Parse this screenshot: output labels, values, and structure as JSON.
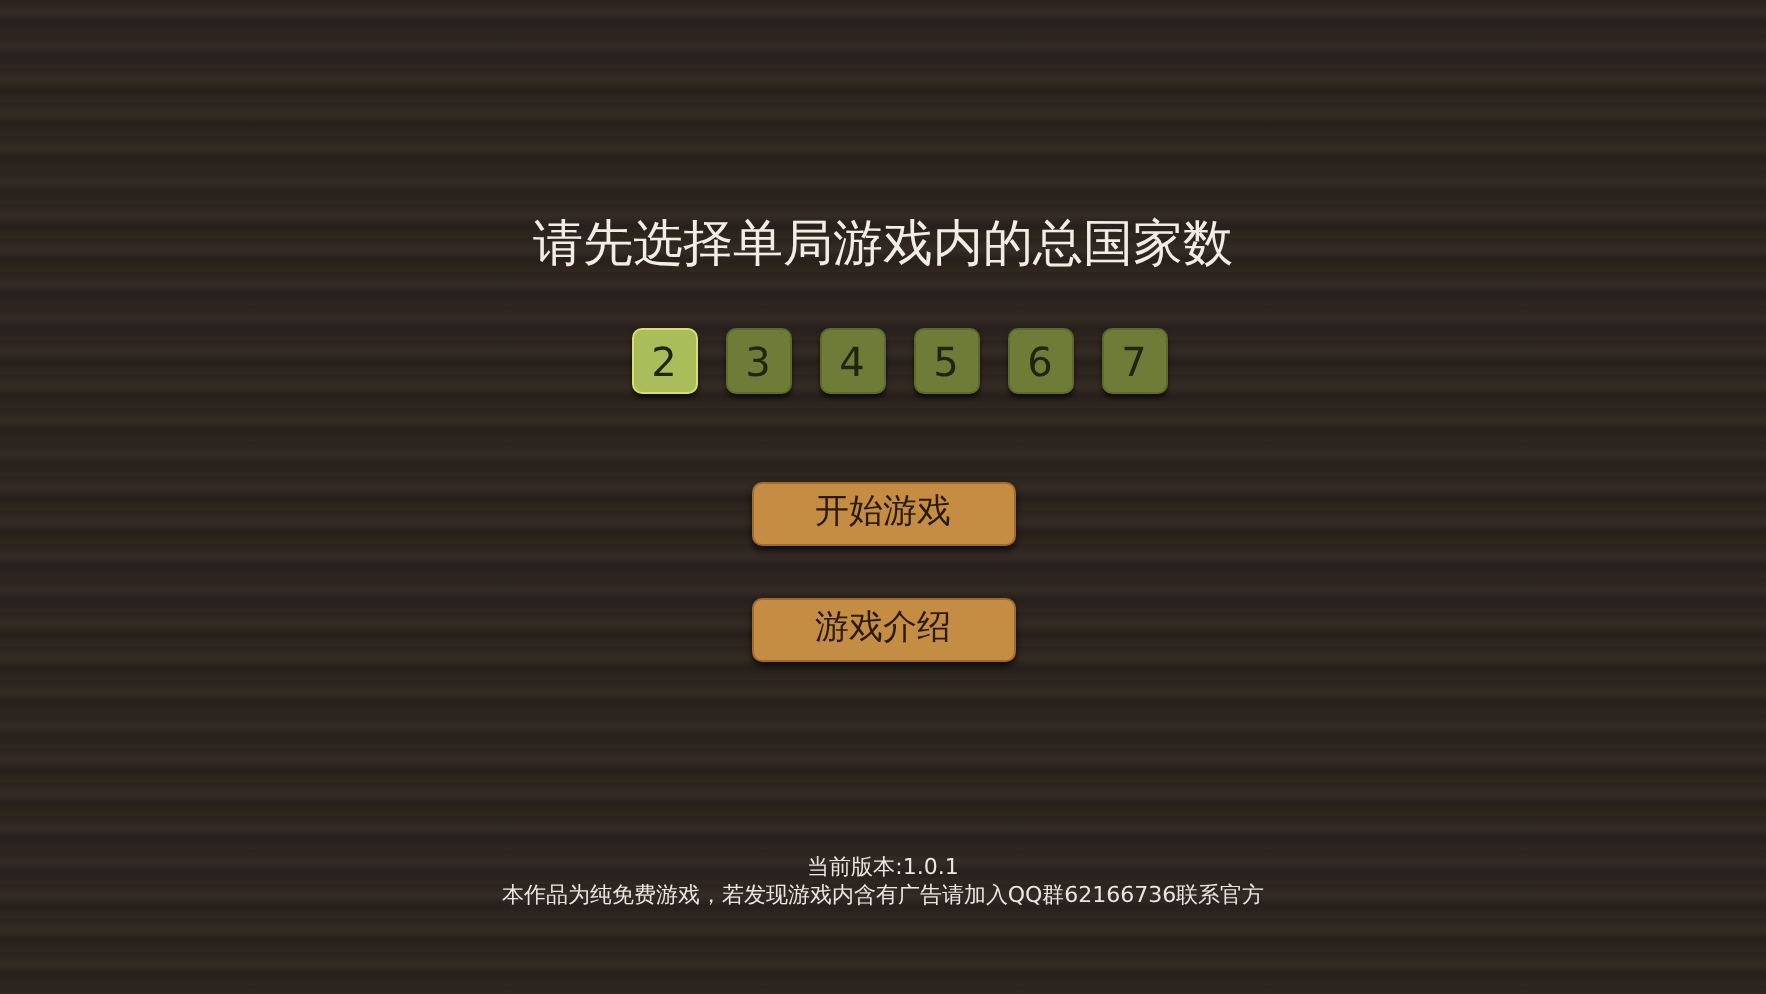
{
  "title": "请先选择单局游戏内的总国家数",
  "counts": [
    {
      "label": "2",
      "selected": true
    },
    {
      "label": "3",
      "selected": false
    },
    {
      "label": "4",
      "selected": false
    },
    {
      "label": "5",
      "selected": false
    },
    {
      "label": "6",
      "selected": false
    },
    {
      "label": "7",
      "selected": false
    }
  ],
  "buttons": [
    "开始游戏",
    "游戏介绍"
  ],
  "footer": {
    "version": "当前版本:1.0.1",
    "notice": "本作品为纯免费游戏，若发现游戏内含有广告请加入QQ群62166736联系官方"
  }
}
